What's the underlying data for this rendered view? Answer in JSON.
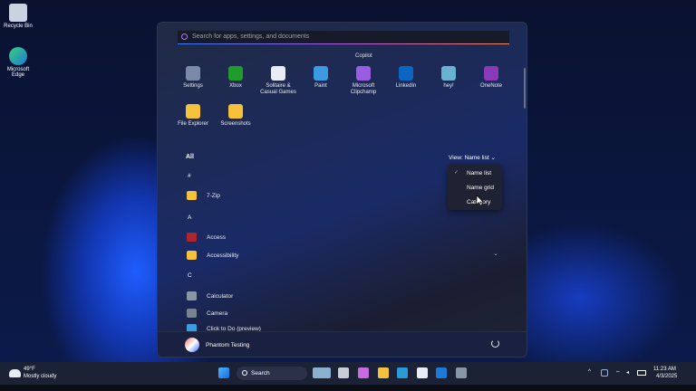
{
  "desktop": {
    "icons": [
      {
        "label": "Recycle Bin",
        "icon": "recycle-bin-icon"
      },
      {
        "label": "Microsoft Edge",
        "icon": "edge-icon"
      }
    ]
  },
  "start_menu": {
    "search_placeholder": "Search for apps, settings, and documents",
    "copilot_label": "Copilot",
    "pinned": [
      {
        "label": "Settings",
        "color": "#7a8aa8"
      },
      {
        "label": "Xbox",
        "color": "#1e9b2a"
      },
      {
        "label": "Solitaire & Casual Games",
        "color": "#e8ecf5"
      },
      {
        "label": "Paint",
        "color": "#3a9be0"
      },
      {
        "label": "Microsoft Clipchamp",
        "color": "#9a5ce0"
      },
      {
        "label": "LinkedIn",
        "color": "#0a66c2"
      },
      {
        "label": "hey!",
        "color": "#6ab0d0"
      },
      {
        "label": "OneNote",
        "color": "#8a3ab8"
      },
      {
        "label": "File Explorer",
        "color": "#f5c23c"
      },
      {
        "label": "Screenshots",
        "color": "#f5c23c"
      }
    ],
    "all_label": "All",
    "view_label": "View: Name list",
    "view_menu": {
      "options": [
        "Name list",
        "Name grid",
        "Category"
      ],
      "selected": "Name list"
    },
    "apps": [
      {
        "type": "header",
        "label": "#"
      },
      {
        "type": "app",
        "label": "7-Zip",
        "color": "#f5c23c"
      },
      {
        "type": "header",
        "label": "A"
      },
      {
        "type": "app",
        "label": "Access",
        "color": "#b0242c"
      },
      {
        "type": "app",
        "label": "Accessibility",
        "color": "#f5c23c",
        "expandable": true
      },
      {
        "type": "header",
        "label": "C"
      },
      {
        "type": "app",
        "label": "Calculator",
        "color": "#8a96a8"
      },
      {
        "type": "app",
        "label": "Camera",
        "color": "#7a8290"
      },
      {
        "type": "app",
        "label": "Click to Do (preview)",
        "color": "#3a9be0"
      }
    ],
    "user": "Phantom Testing"
  },
  "taskbar": {
    "weather": {
      "temp": "49°F",
      "condition": "Mostly cloudy"
    },
    "search_label": "Search",
    "apps": [
      {
        "name": "copilot-widget",
        "color": "#8ab0d0"
      },
      {
        "name": "task-view",
        "color": "#c8ccd6"
      },
      {
        "name": "copilot",
        "color": "#c86ae0"
      },
      {
        "name": "file-explorer",
        "color": "#f5c23c"
      },
      {
        "name": "edge",
        "color": "#2a9ad8"
      },
      {
        "name": "store",
        "color": "#e8ecf5"
      },
      {
        "name": "outlook",
        "color": "#1e7ad8"
      },
      {
        "name": "settings",
        "color": "#8a96a8"
      }
    ],
    "time": "11:23 AM",
    "date": "4/3/2025"
  }
}
